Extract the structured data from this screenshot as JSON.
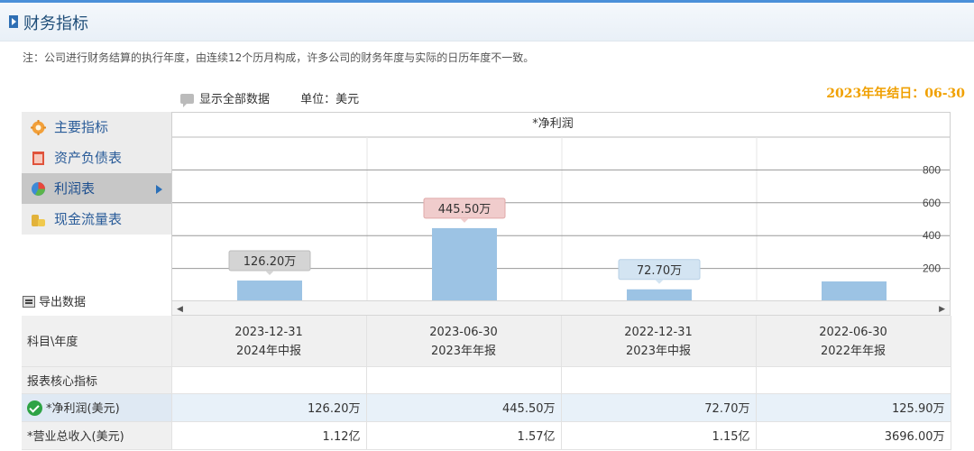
{
  "header": {
    "title": "财务指标"
  },
  "note": "注：公司进行财务结算的执行年度，由连续12个历月构成，许多公司的财务年度与实际的日历年度不一致。",
  "controls": {
    "show_all": "显示全部数据",
    "unit": "单位：美元"
  },
  "fiscal_year_end": "2023年年结日：06-30",
  "sidebar": {
    "items": [
      {
        "label": "主要指标",
        "icon": "gear-icon",
        "active": false
      },
      {
        "label": "资产负债表",
        "icon": "document-icon",
        "active": false
      },
      {
        "label": "利润表",
        "icon": "pie-chart-icon",
        "active": true
      },
      {
        "label": "现金流量表",
        "icon": "coins-icon",
        "active": false
      }
    ]
  },
  "export_label": "导出数据",
  "chart_data": {
    "type": "bar",
    "title": "*净利润",
    "categories": [
      "2023-12-31",
      "2023-06-30",
      "2022-12-31",
      "2022-06-30"
    ],
    "values": [
      126.2,
      445.5,
      72.7,
      125.9
    ],
    "data_labels": [
      "126.20万",
      "445.50万",
      "72.70万",
      ""
    ],
    "ytick_labels": [
      "200",
      "400",
      "600",
      "800"
    ],
    "ylim": [
      0,
      1000
    ],
    "y_axis_side": "right",
    "grid": true,
    "bar_color": "#9cc3e4"
  },
  "table": {
    "corner_label": "科目\\年度",
    "columns": [
      {
        "date": "2023-12-31",
        "report": "2024年中报"
      },
      {
        "date": "2023-06-30",
        "report": "2023年年报"
      },
      {
        "date": "2022-12-31",
        "report": "2023年中报"
      },
      {
        "date": "2022-06-30",
        "report": "2022年年报"
      }
    ],
    "section_label": "报表核心指标",
    "rows": [
      {
        "label": "*净利润(美元)",
        "values": [
          "126.20万",
          "445.50万",
          "72.70万",
          "125.90万"
        ],
        "highlight": true
      },
      {
        "label": "*营业总收入(美元)",
        "values": [
          "1.12亿",
          "1.57亿",
          "1.15亿",
          "3696.00万"
        ],
        "highlight": false
      }
    ]
  }
}
